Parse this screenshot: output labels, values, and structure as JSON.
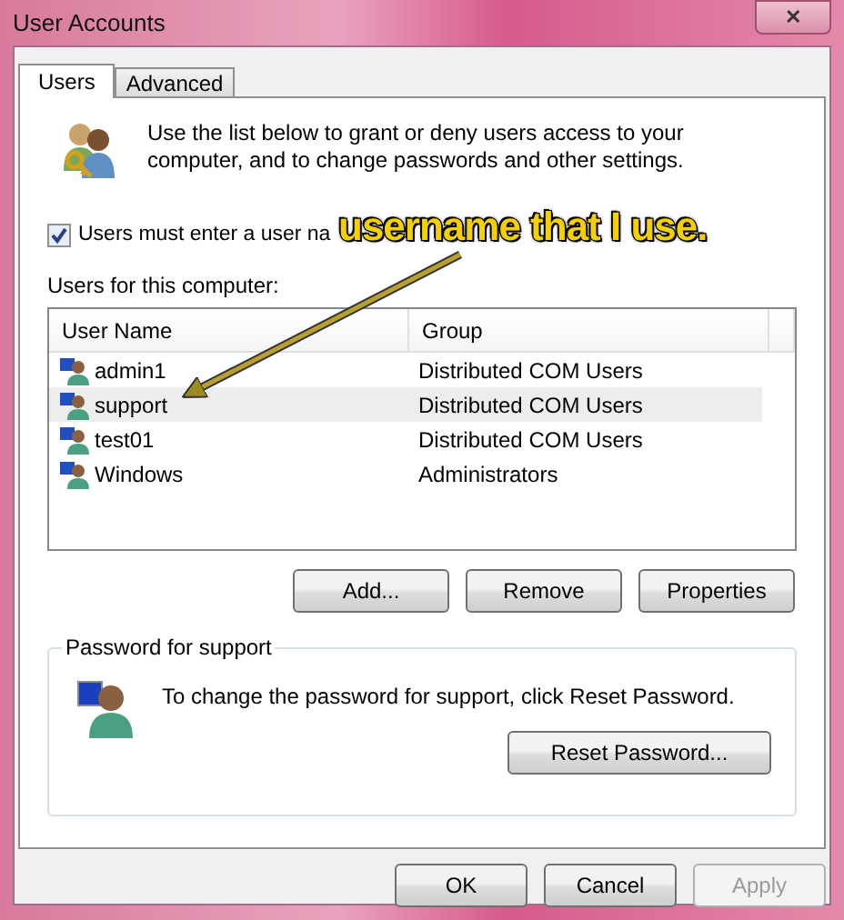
{
  "window": {
    "title": "User Accounts",
    "close": "✕"
  },
  "tabs": [
    {
      "label": "Users",
      "selected": true
    },
    {
      "label": "Advanced",
      "selected": false
    }
  ],
  "intro": "Use the list below to grant or deny users access to your computer, and to change passwords and other settings.",
  "require_login": {
    "label": "Users must enter a user na",
    "checked": true
  },
  "users_label": "Users for this computer:",
  "table": {
    "columns": [
      "User Name",
      "Group"
    ],
    "rows": [
      {
        "name": "admin1",
        "group": "Distributed COM Users",
        "selected": false
      },
      {
        "name": "support",
        "group": "Distributed COM Users",
        "selected": true
      },
      {
        "name": "test01",
        "group": "Distributed COM Users",
        "selected": false
      },
      {
        "name": "Windows",
        "group": "Administrators",
        "selected": false
      }
    ]
  },
  "list_buttons": [
    {
      "label": "Add...",
      "disabled": false
    },
    {
      "label": "Remove",
      "disabled": false
    },
    {
      "label": "Properties",
      "disabled": false
    }
  ],
  "password_group": {
    "title": "Password for support",
    "text": "To change the password for support, click Reset Password.",
    "button": "Reset Password..."
  },
  "dialog_buttons": [
    {
      "label": "OK",
      "disabled": false
    },
    {
      "label": "Cancel",
      "disabled": false
    },
    {
      "label": "Apply",
      "disabled": true
    }
  ],
  "annotation": {
    "text": "username that I use."
  }
}
